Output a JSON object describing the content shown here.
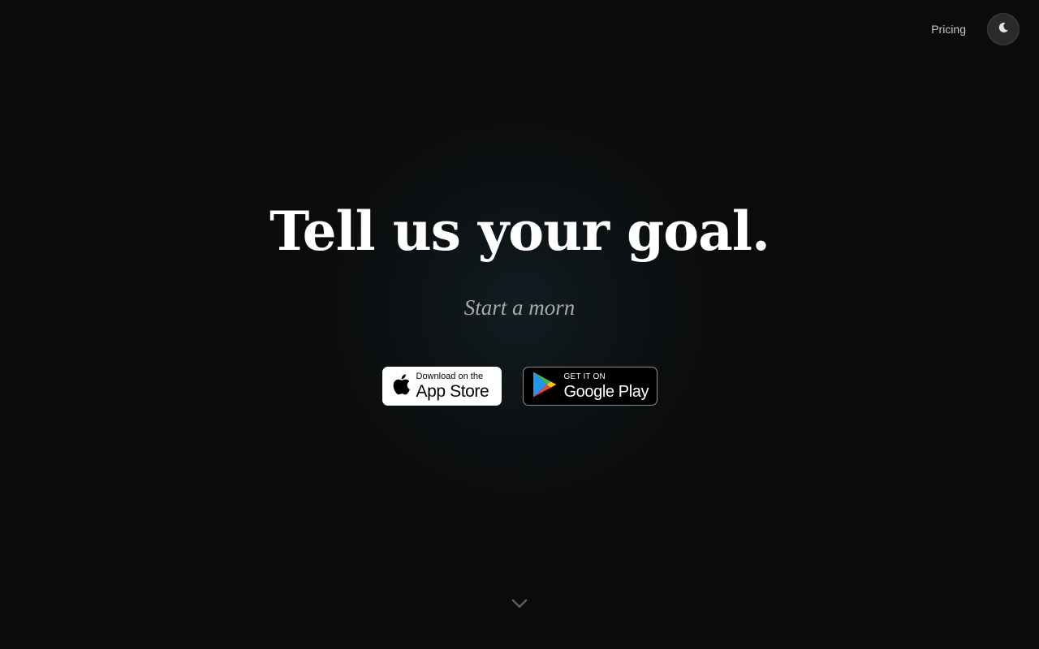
{
  "nav": {
    "pricing_label": "Pricing",
    "theme_toggle_icon": "moon-icon"
  },
  "hero": {
    "headline": "Tell us your goal.",
    "subheadline": "Start a morn"
  },
  "stores": {
    "apple": {
      "small": "Download on the",
      "big": "App Store",
      "icon": "apple-icon"
    },
    "google": {
      "small": "GET IT ON",
      "big": "Google Play",
      "icon": "google-play-icon"
    }
  },
  "scroll_icon": "chevron-down-icon",
  "colors": {
    "background": "#0b0b0b",
    "text": "#ffffff",
    "muted": "#a9a9a9"
  }
}
